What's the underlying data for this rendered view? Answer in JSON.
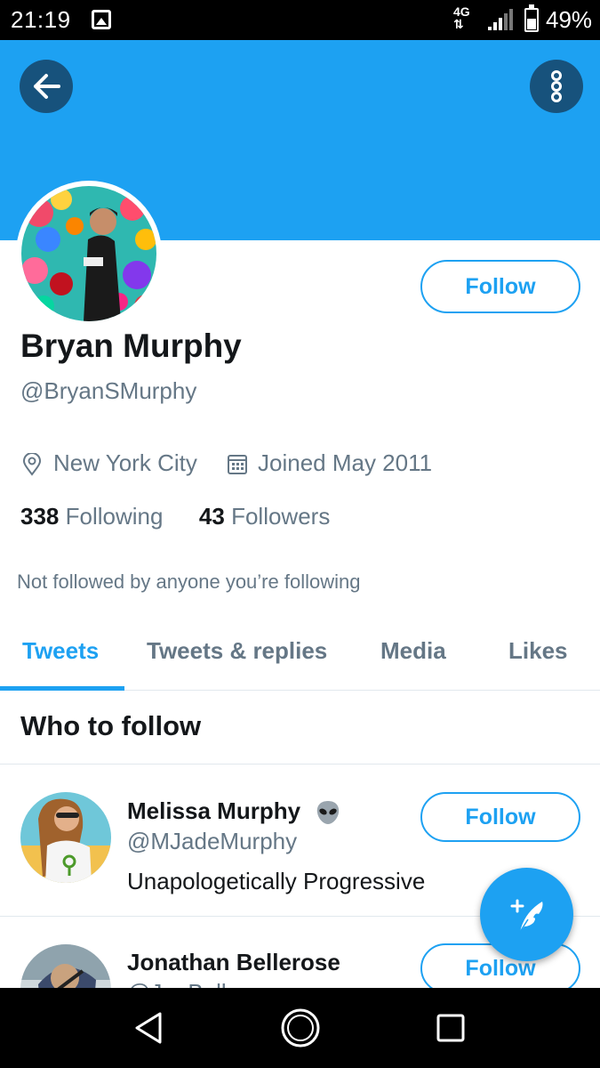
{
  "status_bar": {
    "time": "21:19",
    "network": "4G",
    "battery_percent": "49%",
    "icons": [
      "image-icon",
      "signal-icon",
      "battery-icon"
    ]
  },
  "header": {
    "back_icon": "arrow-left-icon",
    "more_icon": "more-vertical-icon",
    "banner_color": "#1da1f2"
  },
  "profile": {
    "name": "Bryan Murphy",
    "handle": "@BryanSMurphy",
    "follow_label": "Follow",
    "location": "New York City",
    "joined": "Joined May 2011",
    "following_count": "338",
    "following_label": "Following",
    "followers_count": "43",
    "followers_label": "Followers",
    "not_followed_text": "Not followed by anyone you’re following"
  },
  "tabs": [
    {
      "label": "Tweets",
      "active": true
    },
    {
      "label": "Tweets & replies",
      "active": false
    },
    {
      "label": "Media",
      "active": false
    },
    {
      "label": "Likes",
      "active": false
    }
  ],
  "who_to_follow": {
    "title": "Who to follow",
    "items": [
      {
        "name": "Melissa Murphy",
        "handle": "@MJadeMurphy",
        "bio": "Unapologetically Progressive",
        "follow_label": "Follow",
        "badge_icon": "alien-emoji-icon"
      },
      {
        "name": "Jonathan Bellerose",
        "handle": "@JonBellerose",
        "bio": "",
        "follow_label": "Follow"
      }
    ]
  },
  "fab": {
    "icon": "compose-tweet-icon"
  },
  "nav_bar": {
    "icons": [
      "back-triangle-icon",
      "home-circle-icon",
      "recents-square-icon"
    ]
  },
  "colors": {
    "accent": "#1da1f2",
    "secondary_text": "#657786",
    "primary_text": "#14171a"
  }
}
